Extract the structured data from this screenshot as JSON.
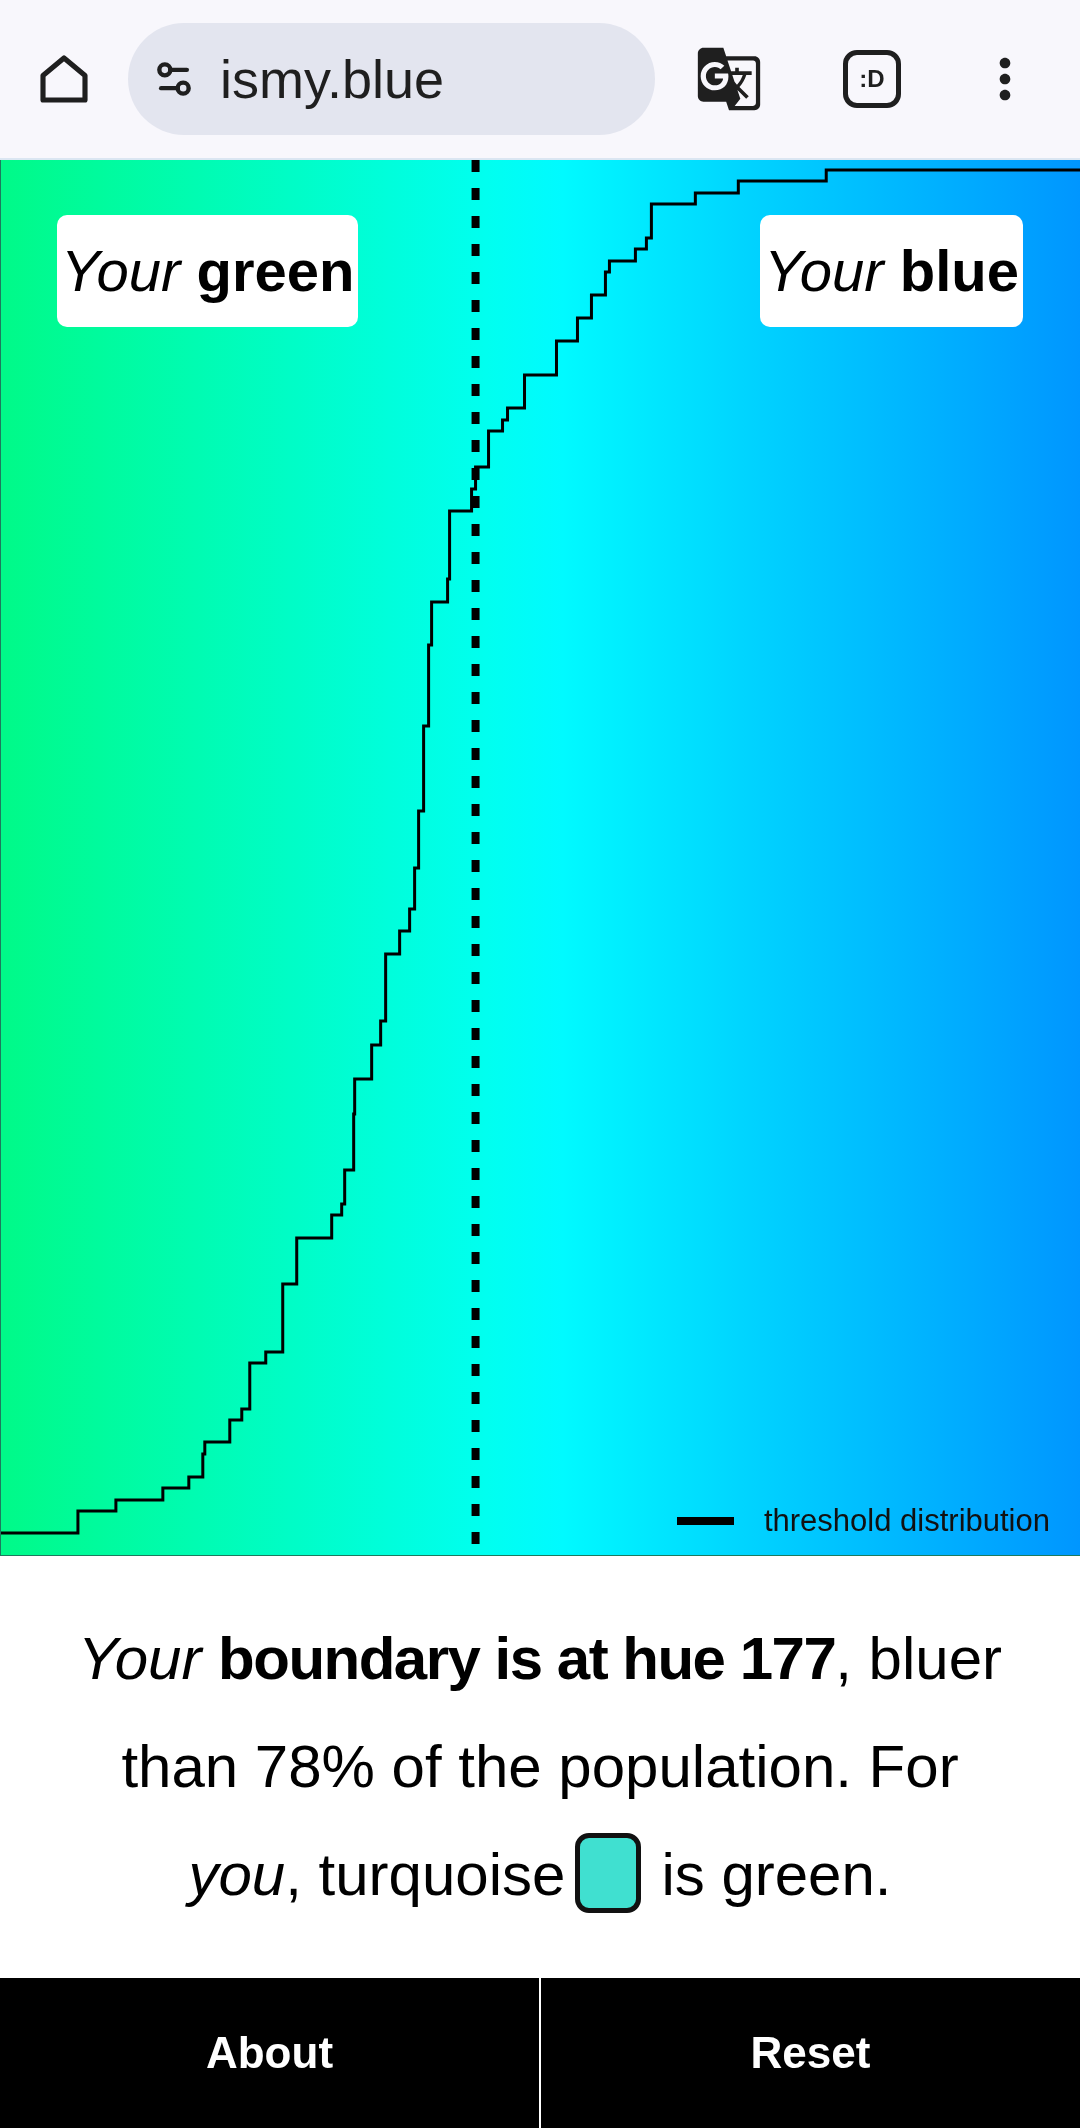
{
  "browser_bar": {
    "url": "ismy.blue",
    "extension_label": ":D"
  },
  "chart": {
    "region_labels": [
      {
        "text": "*Your* **green**"
      },
      {
        "text": "*Your* **blue**"
      }
    ],
    "legend": "threshold distribution"
  },
  "result": {
    "text_before": "*Your* **boundary is at hue 177**, bluer than 78% of the population. For *you*, turquoise",
    "swatch": {
      "color": "#40e0d0"
    },
    "text_after": "is green."
  },
  "buttons": [
    {
      "label": "About"
    },
    {
      "label": "Reset"
    }
  ]
}
